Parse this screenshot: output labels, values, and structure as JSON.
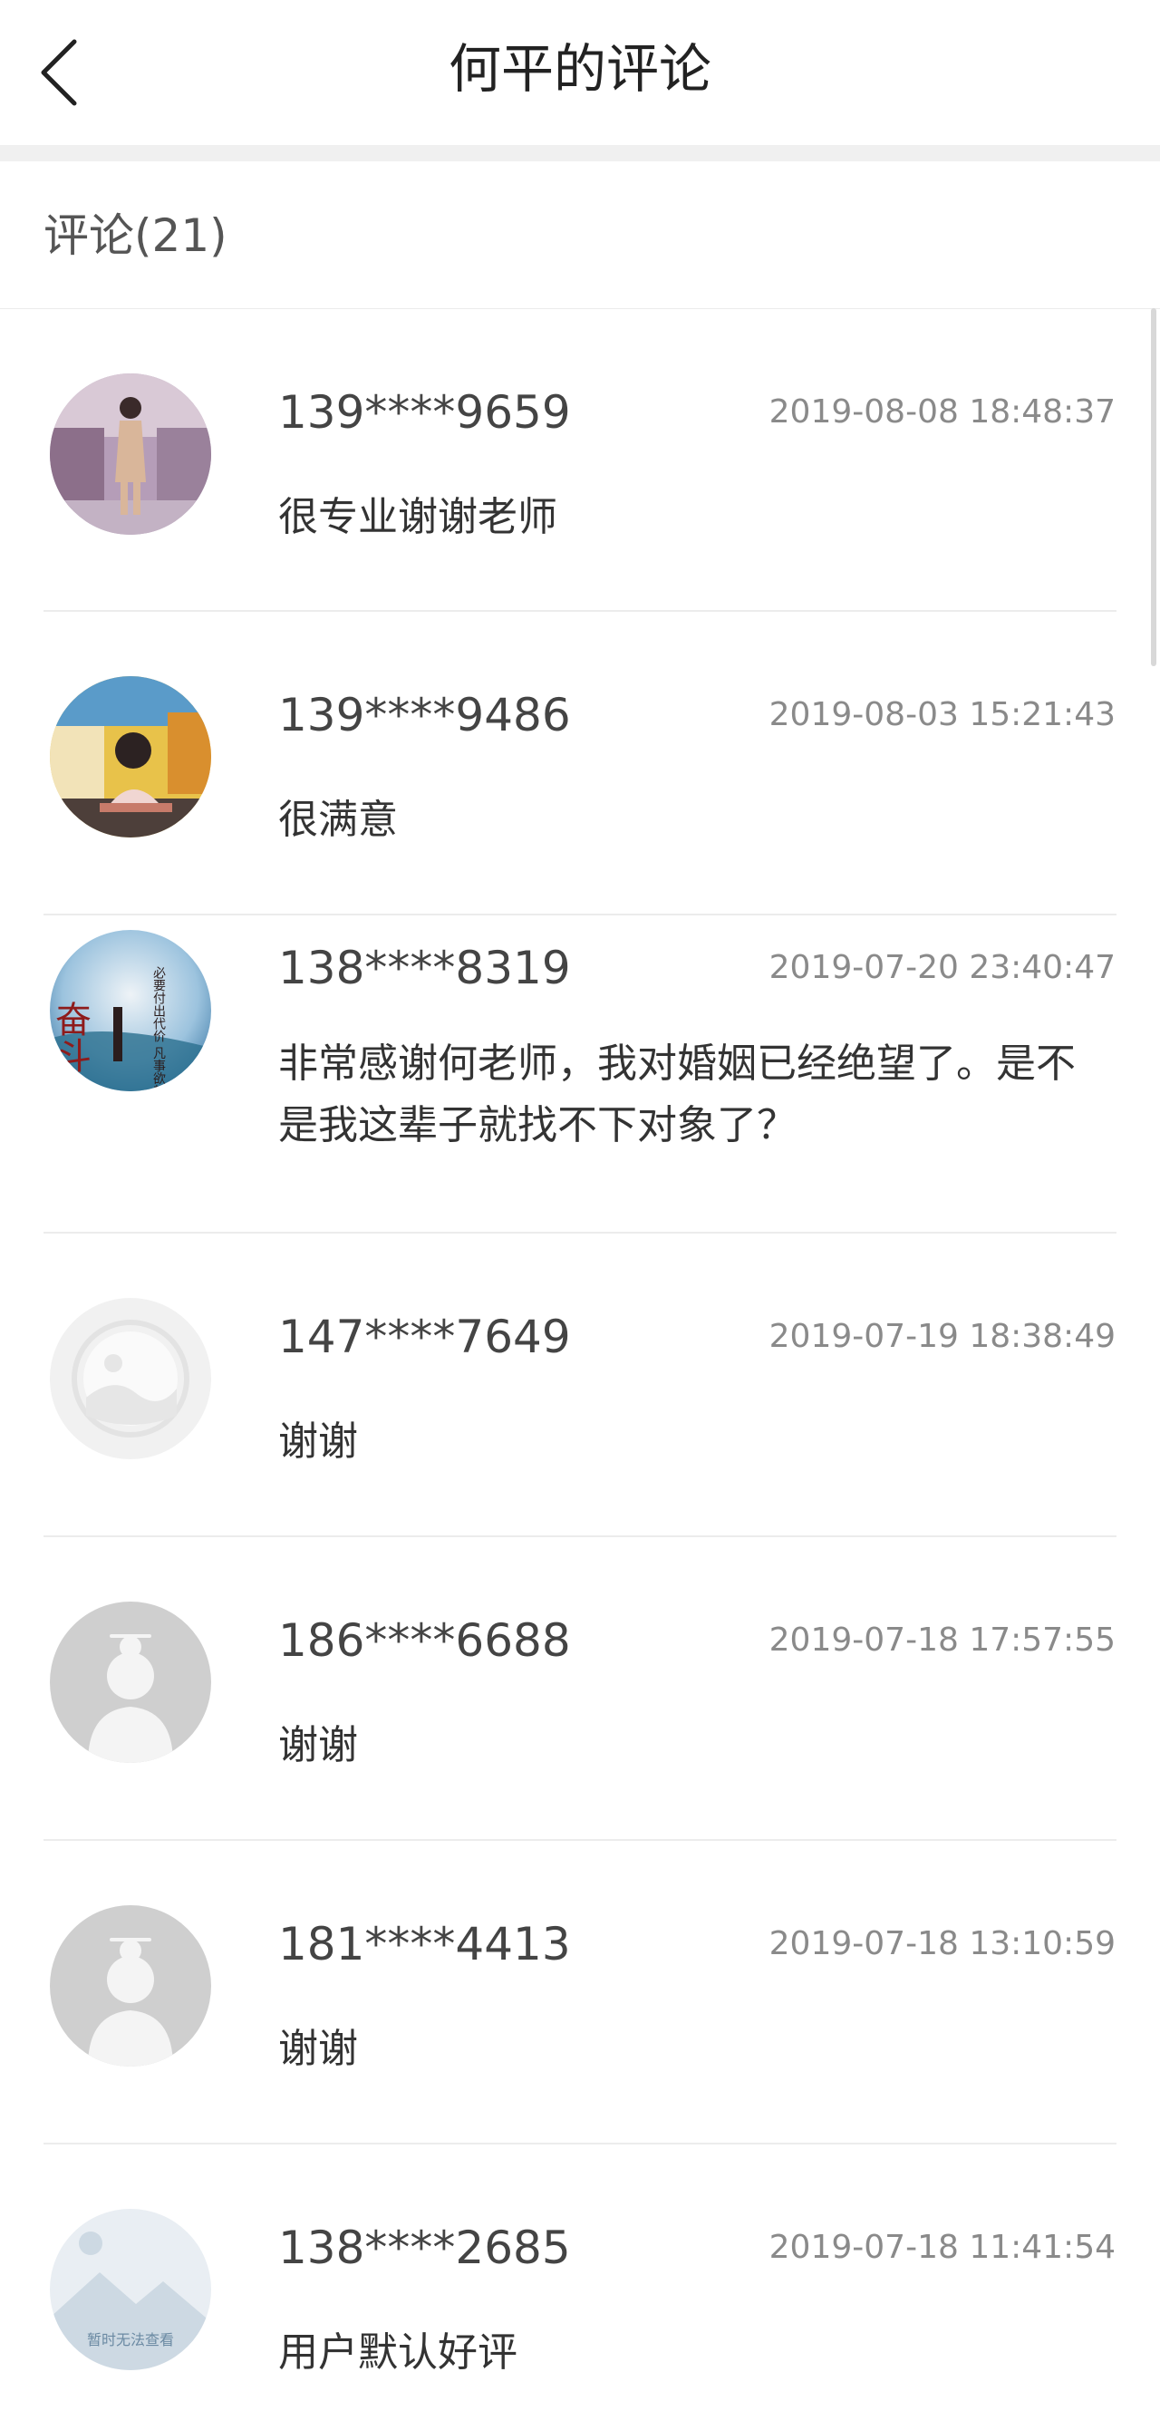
{
  "header": {
    "title": "何平的评论"
  },
  "summary": {
    "count_label": "评论(21)"
  },
  "comments": [
    {
      "user": "139****9659",
      "time": "2019-08-08 18:48:37",
      "text": "很专业谢谢老师",
      "avatar": "photo-woman-standing"
    },
    {
      "user": "139****9486",
      "time": "2019-08-03 15:21:43",
      "text": "很满意",
      "avatar": "photo-woman-sitting"
    },
    {
      "user": "138****8319",
      "time": "2019-07-20 23:40:47",
      "text": "非常感谢何老师，我对婚姻已经绝望了。是不是我这辈子就找不下对象了？",
      "avatar": "calligraphy-fendou",
      "avatar_text": "奋斗",
      "avatar_subtext": "必要付出代价 凡事欲其成功"
    },
    {
      "user": "147****7649",
      "time": "2019-07-19 18:38:49",
      "text": "谢谢",
      "avatar": "placeholder-landscape-icon"
    },
    {
      "user": "186****6688",
      "time": "2019-07-18 17:57:55",
      "text": "谢谢",
      "avatar": "default-female-silhouette"
    },
    {
      "user": "181****4413",
      "time": "2019-07-18 13:10:59",
      "text": "谢谢",
      "avatar": "default-female-silhouette"
    },
    {
      "user": "138****2685",
      "time": "2019-07-18 11:41:54",
      "text": "用户默认好评",
      "avatar": "image-unavailable",
      "avatar_text": "暂时无法查看"
    }
  ],
  "colors": {
    "background": "#ffffff",
    "separator": "#ececec",
    "band": "#f0f0f0",
    "title": "#222222",
    "username": "#444444",
    "timestamp": "#8a8a8a",
    "body": "#333333"
  }
}
